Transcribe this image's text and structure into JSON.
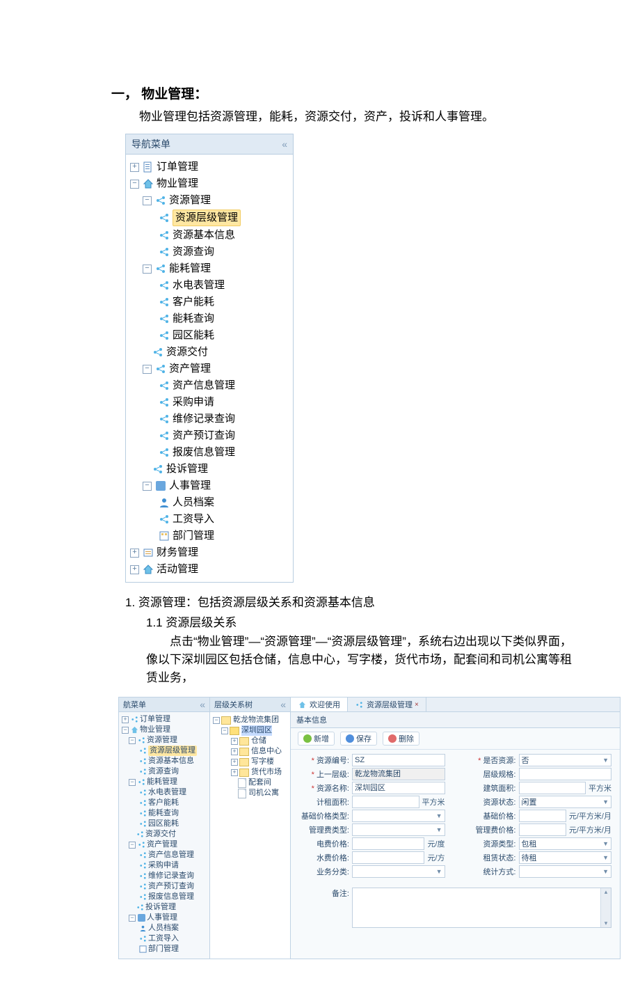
{
  "doc": {
    "heading": "一，  物业管理：",
    "intro": "物业管理包括资源管理，能耗，资源交付，资产，投诉和人事管理。",
    "sec1": "1. 资源管理：包括资源层级关系和资源基本信息",
    "sec11": "1.1 资源层级关系",
    "para": "点击“物业管理”—“资源管理”—“资源层级管理”，系统右边出现以下类似界面，像以下深圳园区包括仓储，信息中心，写字楼，货代市场，配套间和司机公寓等租赁业务，"
  },
  "bigNav": {
    "title": "导航菜单",
    "nodes": {
      "order": "订单管理",
      "property": "物业管理",
      "resource": "资源管理",
      "resLevel": "资源层级管理",
      "resBase": "资源基本信息",
      "resQuery": "资源查询",
      "energy": "能耗管理",
      "meter": "水电表管理",
      "custEnergy": "客户能耗",
      "energyQuery": "能耗查询",
      "parkEnergy": "园区能耗",
      "resDeliver": "资源交付",
      "asset": "资产管理",
      "assetInfo": "资产信息管理",
      "purchase": "采购申请",
      "repair": "维修记录查询",
      "assetResv": "资产预订查询",
      "scrap": "报废信息管理",
      "complaint": "投诉管理",
      "hr": "人事管理",
      "staff": "人员档案",
      "salary": "工资导入",
      "dept": "部门管理",
      "finance": "财务管理",
      "activity": "活动管理"
    }
  },
  "app": {
    "navTitle": "航菜单",
    "treeTitle": "层级关系树",
    "tabs": {
      "welcome": "欢迎使用",
      "resLevel": "资源层级管理"
    },
    "formTab": "基本信息",
    "buttons": {
      "add": "新增",
      "save": "保存",
      "del": "删除"
    },
    "treeNodes": {
      "root": "乾龙物流集团",
      "sz": "深圳园区",
      "c1": "仓储",
      "c2": "信息中心",
      "c3": "写字楼",
      "c4": "货代市场",
      "c5": "配套间",
      "c6": "司机公寓"
    },
    "form": {
      "resCode": {
        "label": "资源编号:",
        "value": "SZ"
      },
      "isRes": {
        "label": "是否资源:",
        "value": "否"
      },
      "parent": {
        "label": "上一层级:",
        "value": "乾龙物流集团"
      },
      "levelSpec": {
        "label": "层级规格:"
      },
      "resName": {
        "label": "资源名称:",
        "value": "深圳园区"
      },
      "buildArea": {
        "label": "建筑面积:",
        "unit": "平方米"
      },
      "billArea": {
        "label": "计租面积:",
        "unit": "平方米"
      },
      "resState": {
        "label": "资源状态:",
        "value": "闲置"
      },
      "basePriceType": {
        "label": "基础价格类型:"
      },
      "basePrice": {
        "label": "基础价格:",
        "unit": "元/平方米/月"
      },
      "feeType": {
        "label": "管理费类型:"
      },
      "feePrice": {
        "label": "管理费价格:",
        "unit": "元/平方米/月"
      },
      "elecPrice": {
        "label": "电费价格:",
        "unit": "元/度"
      },
      "resType": {
        "label": "资源类型:",
        "value": "包租"
      },
      "waterPrice": {
        "label": "水费价格:",
        "unit": "元/方"
      },
      "rentState": {
        "label": "租赁状态:",
        "value": "待租"
      },
      "bizClass": {
        "label": "业务分类:"
      },
      "statMethod": {
        "label": "统计方式:"
      },
      "remark": {
        "label": "备注:"
      }
    }
  }
}
